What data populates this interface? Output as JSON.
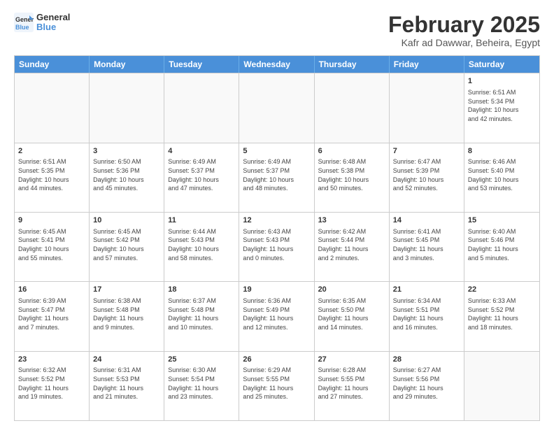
{
  "header": {
    "logo_line1": "General",
    "logo_line2": "Blue",
    "title": "February 2025",
    "subtitle": "Kafr ad Dawwar, Beheira, Egypt"
  },
  "days_of_week": [
    "Sunday",
    "Monday",
    "Tuesday",
    "Wednesday",
    "Thursday",
    "Friday",
    "Saturday"
  ],
  "weeks": [
    [
      {
        "day": "",
        "info": ""
      },
      {
        "day": "",
        "info": ""
      },
      {
        "day": "",
        "info": ""
      },
      {
        "day": "",
        "info": ""
      },
      {
        "day": "",
        "info": ""
      },
      {
        "day": "",
        "info": ""
      },
      {
        "day": "1",
        "info": "Sunrise: 6:51 AM\nSunset: 5:34 PM\nDaylight: 10 hours\nand 42 minutes."
      }
    ],
    [
      {
        "day": "2",
        "info": "Sunrise: 6:51 AM\nSunset: 5:35 PM\nDaylight: 10 hours\nand 44 minutes."
      },
      {
        "day": "3",
        "info": "Sunrise: 6:50 AM\nSunset: 5:36 PM\nDaylight: 10 hours\nand 45 minutes."
      },
      {
        "day": "4",
        "info": "Sunrise: 6:49 AM\nSunset: 5:37 PM\nDaylight: 10 hours\nand 47 minutes."
      },
      {
        "day": "5",
        "info": "Sunrise: 6:49 AM\nSunset: 5:37 PM\nDaylight: 10 hours\nand 48 minutes."
      },
      {
        "day": "6",
        "info": "Sunrise: 6:48 AM\nSunset: 5:38 PM\nDaylight: 10 hours\nand 50 minutes."
      },
      {
        "day": "7",
        "info": "Sunrise: 6:47 AM\nSunset: 5:39 PM\nDaylight: 10 hours\nand 52 minutes."
      },
      {
        "day": "8",
        "info": "Sunrise: 6:46 AM\nSunset: 5:40 PM\nDaylight: 10 hours\nand 53 minutes."
      }
    ],
    [
      {
        "day": "9",
        "info": "Sunrise: 6:45 AM\nSunset: 5:41 PM\nDaylight: 10 hours\nand 55 minutes."
      },
      {
        "day": "10",
        "info": "Sunrise: 6:45 AM\nSunset: 5:42 PM\nDaylight: 10 hours\nand 57 minutes."
      },
      {
        "day": "11",
        "info": "Sunrise: 6:44 AM\nSunset: 5:43 PM\nDaylight: 10 hours\nand 58 minutes."
      },
      {
        "day": "12",
        "info": "Sunrise: 6:43 AM\nSunset: 5:43 PM\nDaylight: 11 hours\nand 0 minutes."
      },
      {
        "day": "13",
        "info": "Sunrise: 6:42 AM\nSunset: 5:44 PM\nDaylight: 11 hours\nand 2 minutes."
      },
      {
        "day": "14",
        "info": "Sunrise: 6:41 AM\nSunset: 5:45 PM\nDaylight: 11 hours\nand 3 minutes."
      },
      {
        "day": "15",
        "info": "Sunrise: 6:40 AM\nSunset: 5:46 PM\nDaylight: 11 hours\nand 5 minutes."
      }
    ],
    [
      {
        "day": "16",
        "info": "Sunrise: 6:39 AM\nSunset: 5:47 PM\nDaylight: 11 hours\nand 7 minutes."
      },
      {
        "day": "17",
        "info": "Sunrise: 6:38 AM\nSunset: 5:48 PM\nDaylight: 11 hours\nand 9 minutes."
      },
      {
        "day": "18",
        "info": "Sunrise: 6:37 AM\nSunset: 5:48 PM\nDaylight: 11 hours\nand 10 minutes."
      },
      {
        "day": "19",
        "info": "Sunrise: 6:36 AM\nSunset: 5:49 PM\nDaylight: 11 hours\nand 12 minutes."
      },
      {
        "day": "20",
        "info": "Sunrise: 6:35 AM\nSunset: 5:50 PM\nDaylight: 11 hours\nand 14 minutes."
      },
      {
        "day": "21",
        "info": "Sunrise: 6:34 AM\nSunset: 5:51 PM\nDaylight: 11 hours\nand 16 minutes."
      },
      {
        "day": "22",
        "info": "Sunrise: 6:33 AM\nSunset: 5:52 PM\nDaylight: 11 hours\nand 18 minutes."
      }
    ],
    [
      {
        "day": "23",
        "info": "Sunrise: 6:32 AM\nSunset: 5:52 PM\nDaylight: 11 hours\nand 19 minutes."
      },
      {
        "day": "24",
        "info": "Sunrise: 6:31 AM\nSunset: 5:53 PM\nDaylight: 11 hours\nand 21 minutes."
      },
      {
        "day": "25",
        "info": "Sunrise: 6:30 AM\nSunset: 5:54 PM\nDaylight: 11 hours\nand 23 minutes."
      },
      {
        "day": "26",
        "info": "Sunrise: 6:29 AM\nSunset: 5:55 PM\nDaylight: 11 hours\nand 25 minutes."
      },
      {
        "day": "27",
        "info": "Sunrise: 6:28 AM\nSunset: 5:55 PM\nDaylight: 11 hours\nand 27 minutes."
      },
      {
        "day": "28",
        "info": "Sunrise: 6:27 AM\nSunset: 5:56 PM\nDaylight: 11 hours\nand 29 minutes."
      },
      {
        "day": "",
        "info": ""
      }
    ]
  ]
}
